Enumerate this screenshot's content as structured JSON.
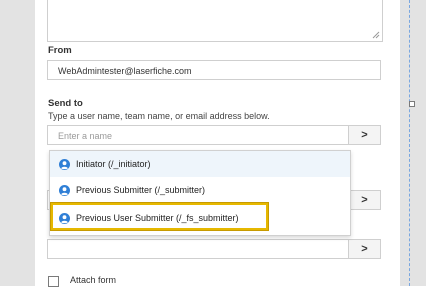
{
  "form": {
    "from": {
      "label": "From",
      "value": "WebAdmintester@laserfiche.com"
    },
    "send_to": {
      "label": "Send to",
      "help": "Type a user name, team name, or email address below.",
      "placeholder": "Enter a name",
      "button": ">"
    },
    "dropdown": {
      "items": [
        {
          "label": "Initiator (/_initiator)"
        },
        {
          "label": "Previous Submitter (/_submitter)"
        },
        {
          "label": "Previous User Submitter (/_fs_submitter)"
        }
      ]
    },
    "hidden_field_button": ">",
    "attachments_button": ">",
    "attach_form": {
      "label": "Attach form"
    }
  },
  "colors": {
    "highlight": "#e6b800",
    "accent_blue": "#2f7fd6"
  }
}
